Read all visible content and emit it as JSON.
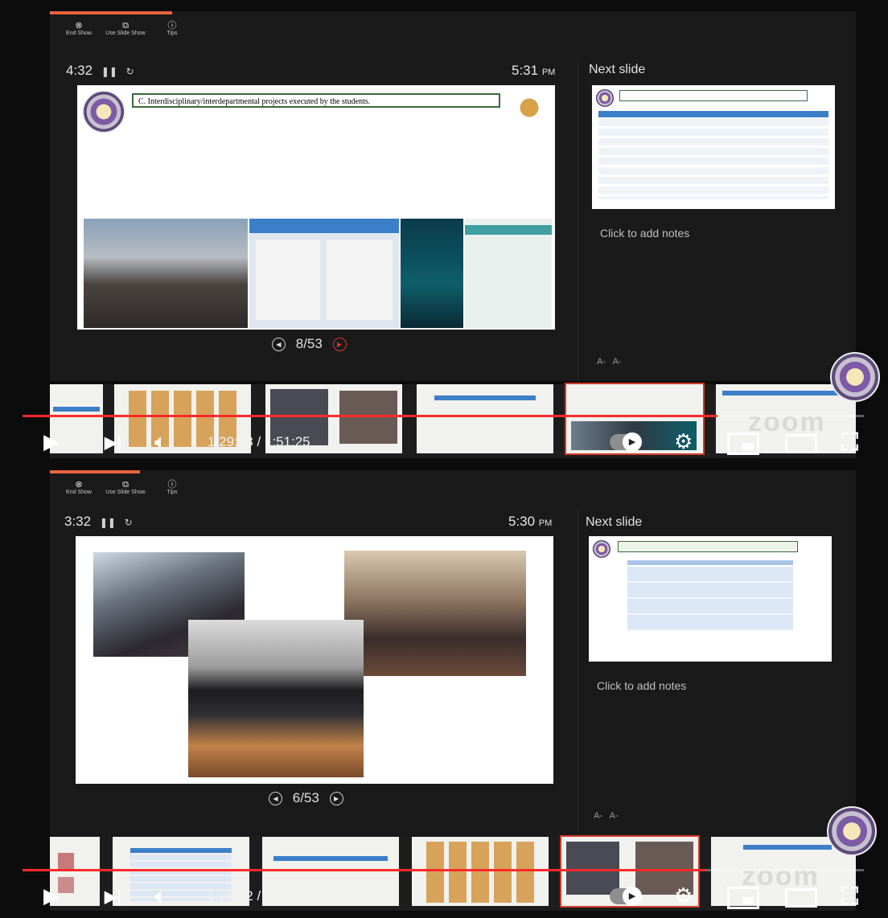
{
  "frames": [
    {
      "toolbar": [
        {
          "icon": "x-circle-icon",
          "label": "End Show"
        },
        {
          "icon": "slides-icon",
          "label": "Use Slide Show"
        },
        {
          "icon": "info-icon",
          "label": "Tips"
        }
      ],
      "timer": "4:32",
      "clock": "5:31",
      "clock_suffix": "PM",
      "slide_heading": "C. Interdisciplinary/interdepartmental projects executed by the students.",
      "slide_counter": "8/53",
      "next_slide_label": "Next slide",
      "notes_placeholder": "Click to add notes",
      "font_decrease": "A-",
      "font_increase": "A-",
      "player_time": "1:29:53 / 1:51:25",
      "played_fraction": 0.78
    },
    {
      "toolbar": [
        {
          "icon": "x-circle-icon",
          "label": "End Show"
        },
        {
          "icon": "slides-icon",
          "label": "Use Slide Show"
        },
        {
          "icon": "info-icon",
          "label": "Tips"
        }
      ],
      "timer": "3:32",
      "clock": "5:30",
      "clock_suffix": "PM",
      "slide_counter": "6/53",
      "next_slide_label": "Next slide",
      "notes_placeholder": "Click to add notes",
      "font_decrease": "A-",
      "font_increase": "A-",
      "player_time": "1:28:52 / 1:51:25",
      "played_fraction": 0.78
    }
  ],
  "watermark": "zoom",
  "colors": {
    "accent": "#ff2a2a",
    "selected_thumb": "#d23a2a",
    "timer_bar": "#e8643c"
  }
}
